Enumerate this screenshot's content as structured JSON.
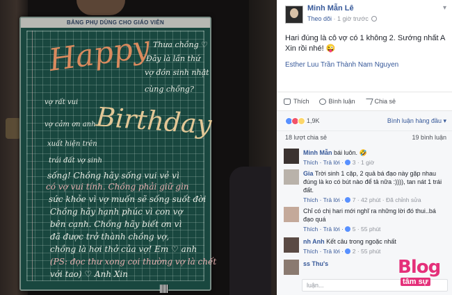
{
  "board": {
    "title": "BẢNG PHỤ DÙNG CHO GIÁO VIÊN",
    "chalk_lines": {
      "happy": "Happy",
      "birthday": "Birthday",
      "l1": "Thưa chồng ♡",
      "l2": "Đây là lần thứ",
      "l3": "vợ đón sinh nhật",
      "l4": "cùng chồng?",
      "l5": "vợ rất vui",
      "l6": "vợ cảm ơn anh",
      "l7": "xuất hiện trên",
      "l8": "trái đất vợ sinh",
      "l9": "sống! Chồng hãy sống vui vẻ vì",
      "l10": "có vợ vui tính. Chồng phải giữ gìn",
      "l11": "sức khỏe vì vợ muốn sẽ sống suốt đời",
      "l12": "Chồng hãy hạnh phúc vì con vợ",
      "l13": "bên cạnh. Chồng hãy biết ơn vì",
      "l14": "đã được trở thành chồng vợ,",
      "l15": "chồng là hơi thở của vợ! Em ♡ anh",
      "l16": "(PS: đọc thư xong coi thường vợ là chết",
      "l17": "với tao) ♡ Anh Xin"
    }
  },
  "post": {
    "author": "Minh Mẫn Lê",
    "follow": "Theo dõi",
    "time": "1 giờ trước",
    "text": "Hari đúng là cô vợ có 1 không 2. Sướng nhất A Xin rồi nhé! 😜",
    "tags": "Esther Luu Trần Thành Nam Nguyen",
    "actions": {
      "like": "Thích",
      "comment": "Bình luận",
      "share": "Chia sẻ"
    },
    "reaction_count": "1,9K",
    "sort_label": "Bình luận hàng đầu ▾",
    "share_count": "18 lượt chia sẻ",
    "comment_count": "19 bình luận"
  },
  "comments": [
    {
      "name": "Minh Mẫn",
      "text": "bái luôn. 🤣",
      "reply": "Thích · Trả lời ·",
      "likes": "3",
      "time": "· 1 giờ"
    },
    {
      "name": "Gia",
      "text": "Trời sinh 1 cặp, 2 quả bá đạo này gặp nhau đúng là ko có bút nào để tả nữa :)))), tan nát 1 trái đất.",
      "reply": "Thích · Trả lời ·",
      "likes": "7",
      "time": "· 42 phút · Đã chỉnh sửa"
    },
    {
      "name": "",
      "text": "Chỉ có chị hari mới nghĩ ra những lời đó thui..bá đạo quá",
      "reply": "Thích · Trả lời ·",
      "likes": "5",
      "time": "· 55 phút"
    },
    {
      "name": "nh Anh",
      "text": "Kết câu trong ngoặc nhất",
      "reply": "Thích · Trả lời ·",
      "likes": "2",
      "time": "· 55 phút"
    },
    {
      "name": "ss Thu's",
      "text": "",
      "reply": "",
      "likes": "",
      "time": ""
    }
  ],
  "reply_placeholder": "luận...",
  "watermark": {
    "logo": "Blog",
    "sub": "tâm sự"
  },
  "colors": {
    "link": "#365899",
    "board": "#19473f",
    "brand_pink": "#e4307a"
  }
}
